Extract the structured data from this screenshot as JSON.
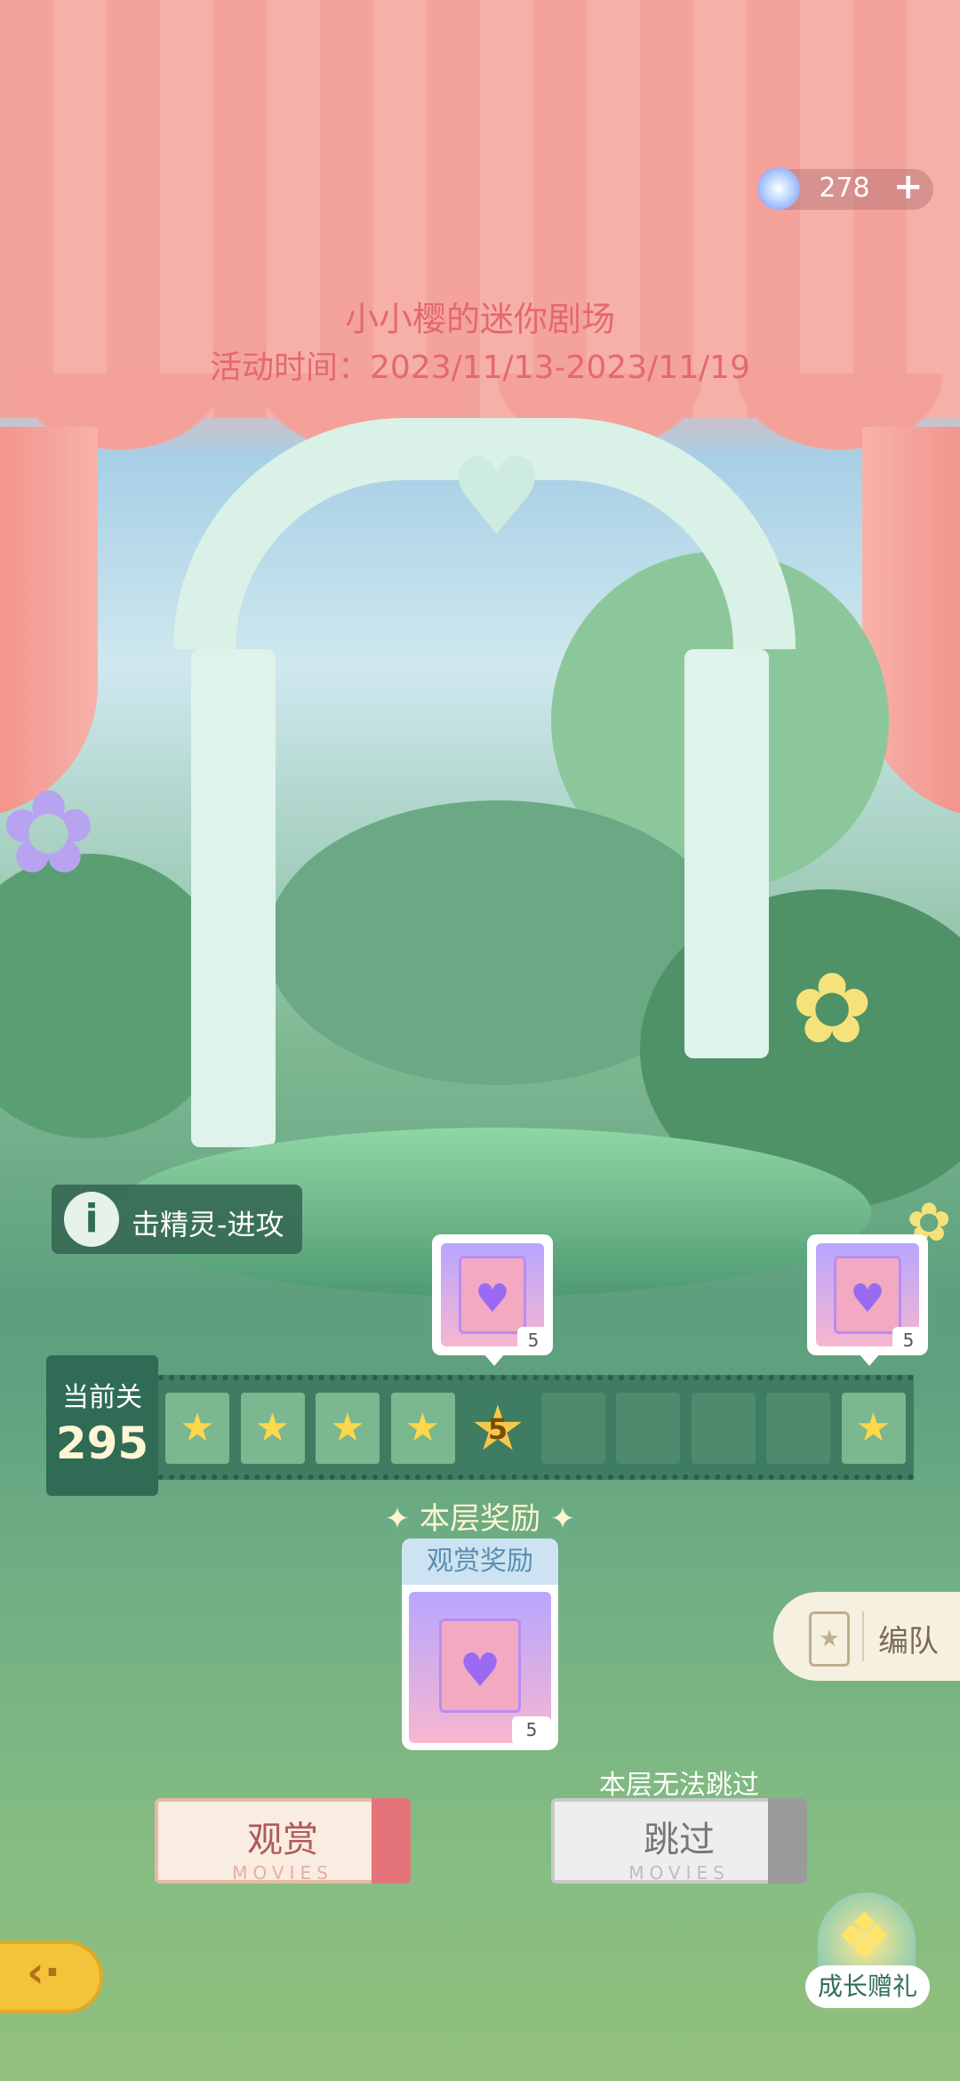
{
  "currency": {
    "icon": "snowflake-gem-icon",
    "value": "278",
    "plus": "+"
  },
  "header": {
    "title": "小小樱的迷你剧场",
    "subtitle": "活动时间：2023/11/13-2023/11/19"
  },
  "attack_badge": {
    "icon": "info-icon",
    "icon_glyph": "i",
    "label": "击精灵-进攻"
  },
  "level": {
    "label": "当前关",
    "value": "295"
  },
  "track": {
    "slots": [
      "star",
      "star",
      "star",
      "star",
      "current",
      "empty",
      "empty",
      "empty",
      "empty",
      "star"
    ],
    "current_number": "5",
    "star_glyph": "★"
  },
  "track_rewards": [
    {
      "icon": "gift-bag-icon",
      "quantity": "5"
    },
    {
      "icon": "gift-bag-icon",
      "quantity": "5"
    }
  ],
  "floor_reward": {
    "title": "✦ 本层奖励 ✦",
    "tab_label": "观赏奖励",
    "icon": "gift-bag-icon",
    "quantity": "5"
  },
  "team_button": {
    "icon": "card-icon",
    "label": "编队"
  },
  "watch_button": {
    "label": "观赏",
    "sub": "MOVIES"
  },
  "skip_button": {
    "label": "跳过",
    "sub": "MOVIES",
    "note": "本层无法跳过"
  },
  "back_button": {
    "icon": "back-arrow-icon",
    "glyph": "‹·"
  },
  "growth_gift": {
    "icon": "gift-box-icon",
    "label": "成长赠礼"
  },
  "colors": {
    "title": "#e46870",
    "track": "#3f7d62",
    "star": "#ffd84a",
    "watch_stub": "#e4747a"
  }
}
